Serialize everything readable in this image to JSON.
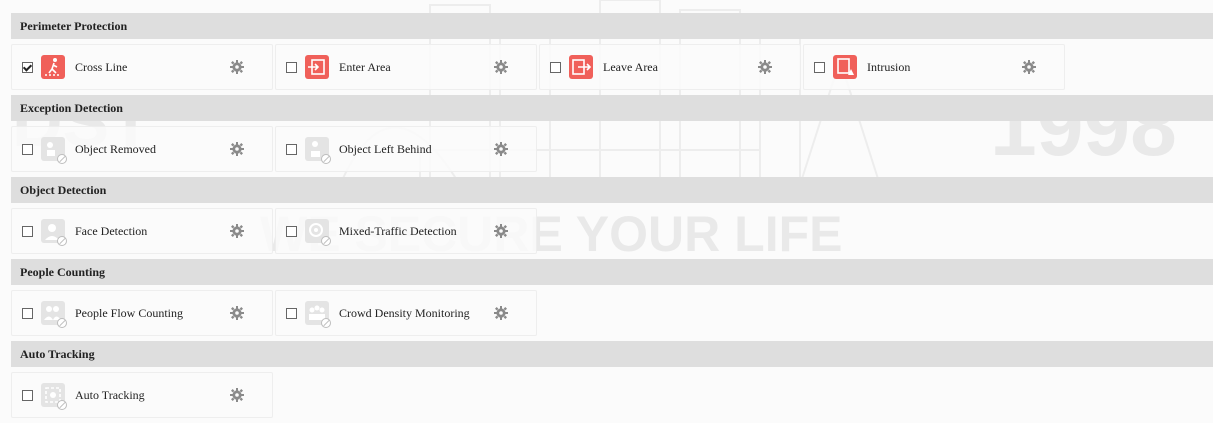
{
  "watermark": {
    "left_text": "DST",
    "right_text": "1998",
    "slogan": "WE SECURE YOUR LIFE"
  },
  "sections": [
    {
      "title": "Perimeter Protection",
      "items": [
        {
          "label": "Cross Line",
          "checked": true,
          "enabled": true,
          "icon": "cross-line-icon"
        },
        {
          "label": "Enter Area",
          "checked": false,
          "enabled": true,
          "icon": "enter-area-icon"
        },
        {
          "label": "Leave Area",
          "checked": false,
          "enabled": true,
          "icon": "leave-area-icon"
        },
        {
          "label": "Intrusion",
          "checked": false,
          "enabled": true,
          "icon": "intrusion-icon"
        }
      ]
    },
    {
      "title": "Exception Detection",
      "items": [
        {
          "label": "Object Removed",
          "checked": false,
          "enabled": false,
          "icon": "object-removed-icon"
        },
        {
          "label": "Object Left Behind",
          "checked": false,
          "enabled": false,
          "icon": "object-left-behind-icon"
        }
      ]
    },
    {
      "title": "Object Detection",
      "items": [
        {
          "label": "Face Detection",
          "checked": false,
          "enabled": false,
          "icon": "face-detection-icon"
        },
        {
          "label": "Mixed-Traffic Detection",
          "checked": false,
          "enabled": false,
          "icon": "mixed-traffic-icon"
        }
      ]
    },
    {
      "title": "People Counting",
      "items": [
        {
          "label": "People Flow Counting",
          "checked": false,
          "enabled": false,
          "icon": "people-flow-icon"
        },
        {
          "label": "Crowd Density Monitoring",
          "checked": false,
          "enabled": false,
          "icon": "crowd-density-icon"
        }
      ]
    },
    {
      "title": "Auto Tracking",
      "items": [
        {
          "label": "Auto Tracking",
          "checked": false,
          "enabled": false,
          "icon": "auto-tracking-icon"
        }
      ]
    }
  ],
  "colors": {
    "active_icon": "#f0605a",
    "inactive_icon": "#e4e4e4",
    "header_bg": "#dedede",
    "gear": "#8a8a8a"
  }
}
